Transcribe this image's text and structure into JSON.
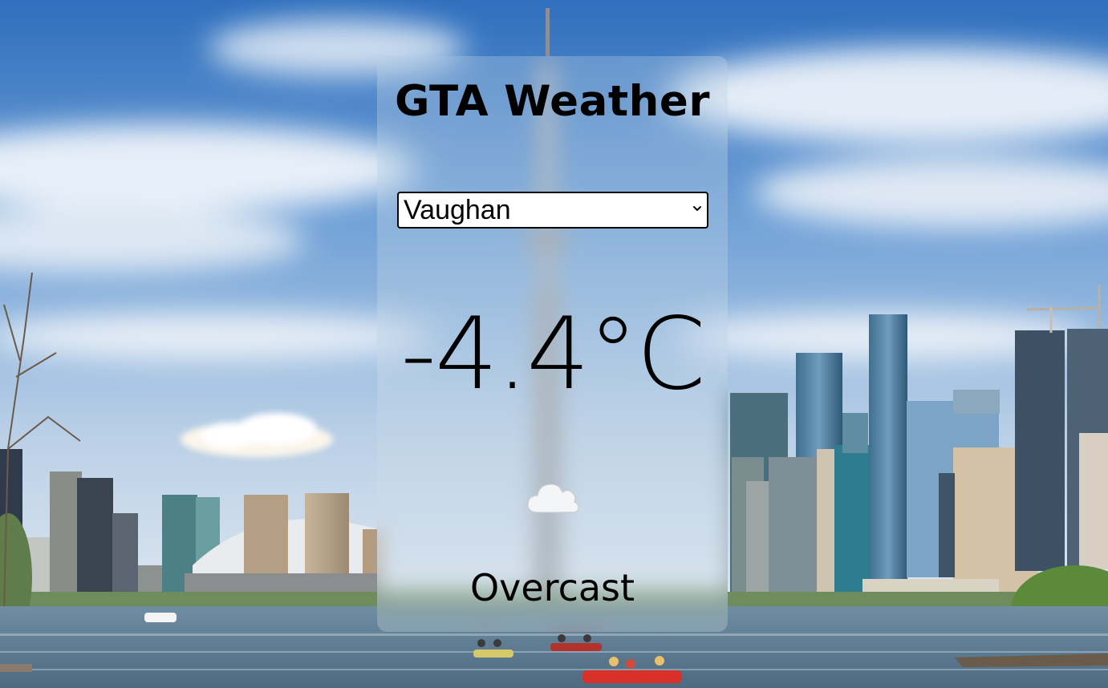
{
  "app": {
    "title": "GTA Weather"
  },
  "location_select": {
    "selected": "Vaughan",
    "options": [
      "Vaughan"
    ]
  },
  "current": {
    "temperature": "-4.4°C",
    "condition": "Overcast",
    "icon": "cloud-icon"
  },
  "theme": {
    "sky_top": "#3f7fc7",
    "sky_bottom": "#dbe6f0",
    "water": "#5f7f94",
    "card_tint": "#d2deeb",
    "text": "#000000"
  }
}
